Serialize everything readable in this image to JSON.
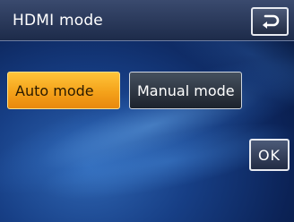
{
  "header": {
    "title": "HDMI mode"
  },
  "buttons": {
    "back_icon": "return-arrow-icon",
    "auto_label": "Auto mode",
    "manual_label": "Manual mode",
    "ok_label": "OK"
  },
  "state": {
    "selected_mode": "Auto mode"
  },
  "colors": {
    "selected_accent": "#f4a21a",
    "unselected_button": "#2a313c",
    "header_bg": "#2a3858"
  }
}
